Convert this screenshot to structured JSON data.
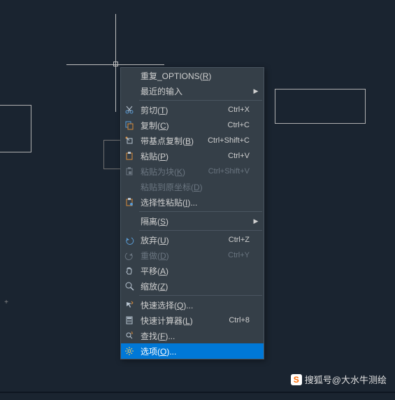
{
  "watermark": {
    "logo": "S",
    "text": "搜狐号@大水牛测绘"
  },
  "ruler_mark": "+",
  "menu": {
    "items": [
      {
        "id": "repeat-options",
        "label": "重复_OPTIONS(R)",
        "mnemonic": "R",
        "shortcut": "",
        "icon": "",
        "disabled": false,
        "submenu": false
      },
      {
        "id": "recent-input",
        "label": "最近的输入",
        "mnemonic": "",
        "shortcut": "",
        "icon": "",
        "disabled": false,
        "submenu": true
      },
      {
        "sep": true
      },
      {
        "id": "cut",
        "label": "剪切(T)",
        "mnemonic": "T",
        "shortcut": "Ctrl+X",
        "icon": "scissors",
        "disabled": false,
        "submenu": false
      },
      {
        "id": "copy",
        "label": "复制(C)",
        "mnemonic": "C",
        "shortcut": "Ctrl+C",
        "icon": "copy",
        "disabled": false,
        "submenu": false
      },
      {
        "id": "copy-base",
        "label": "带基点复制(B)",
        "mnemonic": "B",
        "shortcut": "Ctrl+Shift+C",
        "icon": "copy-base",
        "disabled": false,
        "submenu": false
      },
      {
        "id": "paste",
        "label": "粘贴(P)",
        "mnemonic": "P",
        "shortcut": "Ctrl+V",
        "icon": "paste",
        "disabled": false,
        "submenu": false
      },
      {
        "id": "paste-block",
        "label": "粘贴为块(K)",
        "mnemonic": "K",
        "shortcut": "Ctrl+Shift+V",
        "icon": "paste-block",
        "disabled": true,
        "submenu": false
      },
      {
        "id": "paste-orig",
        "label": "粘贴到原坐标(D)",
        "mnemonic": "D",
        "shortcut": "",
        "icon": "",
        "disabled": true,
        "submenu": false
      },
      {
        "id": "paste-special",
        "label": "选择性粘贴(I)...",
        "mnemonic": "I",
        "shortcut": "",
        "icon": "paste-special",
        "disabled": false,
        "submenu": false
      },
      {
        "sep": true
      },
      {
        "id": "isolate",
        "label": "隔离(S)",
        "mnemonic": "S",
        "shortcut": "",
        "icon": "",
        "disabled": false,
        "submenu": true
      },
      {
        "sep": true
      },
      {
        "id": "undo",
        "label": "放弃(U)",
        "mnemonic": "U",
        "shortcut": "Ctrl+Z",
        "icon": "undo",
        "disabled": false,
        "submenu": false
      },
      {
        "id": "redo",
        "label": "重做(D)",
        "mnemonic": "D",
        "shortcut": "Ctrl+Y",
        "icon": "redo",
        "disabled": true,
        "submenu": false
      },
      {
        "id": "pan",
        "label": "平移(A)",
        "mnemonic": "A",
        "shortcut": "",
        "icon": "pan",
        "disabled": false,
        "submenu": false
      },
      {
        "id": "zoom",
        "label": "缩放(Z)",
        "mnemonic": "Z",
        "shortcut": "",
        "icon": "zoom",
        "disabled": false,
        "submenu": false
      },
      {
        "sep": true
      },
      {
        "id": "qselect",
        "label": "快速选择(Q)...",
        "mnemonic": "Q",
        "shortcut": "",
        "icon": "qselect",
        "disabled": false,
        "submenu": false
      },
      {
        "id": "qcalc",
        "label": "快速计算器(L)",
        "mnemonic": "L",
        "shortcut": "Ctrl+8",
        "icon": "calc",
        "disabled": false,
        "submenu": false
      },
      {
        "id": "find",
        "label": "查找(F)...",
        "mnemonic": "F",
        "shortcut": "",
        "icon": "find",
        "disabled": false,
        "submenu": false
      },
      {
        "id": "options",
        "label": "选项(O)...",
        "mnemonic": "O",
        "shortcut": "",
        "icon": "gear",
        "disabled": false,
        "submenu": false,
        "highlighted": true
      }
    ]
  }
}
